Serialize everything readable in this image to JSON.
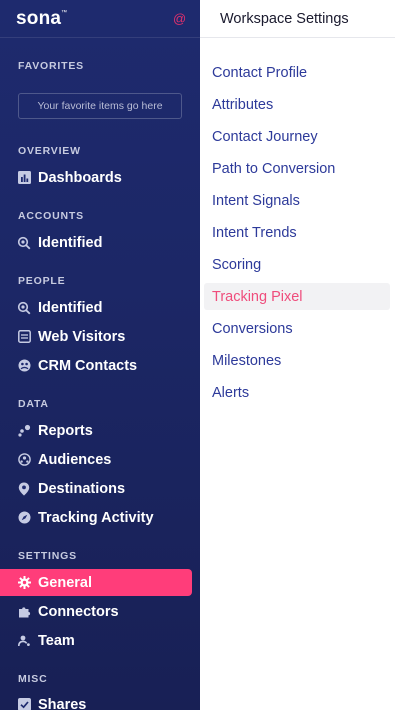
{
  "brand": {
    "name": "sona",
    "trademark": "™",
    "icon": "at-icon"
  },
  "sidebar": {
    "favorites": {
      "title": "FAVORITES",
      "placeholder": "Your favorite items go here"
    },
    "overview": {
      "title": "OVERVIEW",
      "items": [
        {
          "label": "Dashboards",
          "icon": "bar-chart-icon"
        }
      ]
    },
    "accounts": {
      "title": "ACCOUNTS",
      "items": [
        {
          "label": "Identified",
          "icon": "search-icon"
        }
      ]
    },
    "people": {
      "title": "PEOPLE",
      "items": [
        {
          "label": "Identified",
          "icon": "search-icon"
        },
        {
          "label": "Web Visitors",
          "icon": "browser-icon"
        },
        {
          "label": "CRM Contacts",
          "icon": "contacts-icon"
        }
      ]
    },
    "data": {
      "title": "DATA",
      "items": [
        {
          "label": "Reports",
          "icon": "scatter-icon"
        },
        {
          "label": "Audiences",
          "icon": "audience-icon"
        },
        {
          "label": "Destinations",
          "icon": "map-pin-icon"
        },
        {
          "label": "Tracking Activity",
          "icon": "compass-icon"
        }
      ]
    },
    "settings": {
      "title": "SETTINGS",
      "items": [
        {
          "label": "General",
          "icon": "gear-icon",
          "active": true
        },
        {
          "label": "Connectors",
          "icon": "puzzle-icon"
        },
        {
          "label": "Team",
          "icon": "team-icon"
        }
      ]
    },
    "misc": {
      "title": "MISC",
      "items": [
        {
          "label": "Shares",
          "icon": "check-square-icon"
        }
      ]
    }
  },
  "panel": {
    "title": "Workspace Settings",
    "links": [
      {
        "label": "Contact Profile"
      },
      {
        "label": "Attributes"
      },
      {
        "label": "Contact Journey"
      },
      {
        "label": "Path to Conversion"
      },
      {
        "label": "Intent Signals"
      },
      {
        "label": "Intent Trends"
      },
      {
        "label": "Scoring"
      },
      {
        "label": "Tracking Pixel",
        "active": true
      },
      {
        "label": "Conversions"
      },
      {
        "label": "Milestones"
      },
      {
        "label": "Alerts"
      }
    ]
  },
  "colors": {
    "sidebar_bg": "#1e2a6e",
    "accent_active": "#ff3d7a",
    "link": "#2d3a9a",
    "link_active": "#ef4d7c",
    "logo_icon": "#e0306c"
  }
}
